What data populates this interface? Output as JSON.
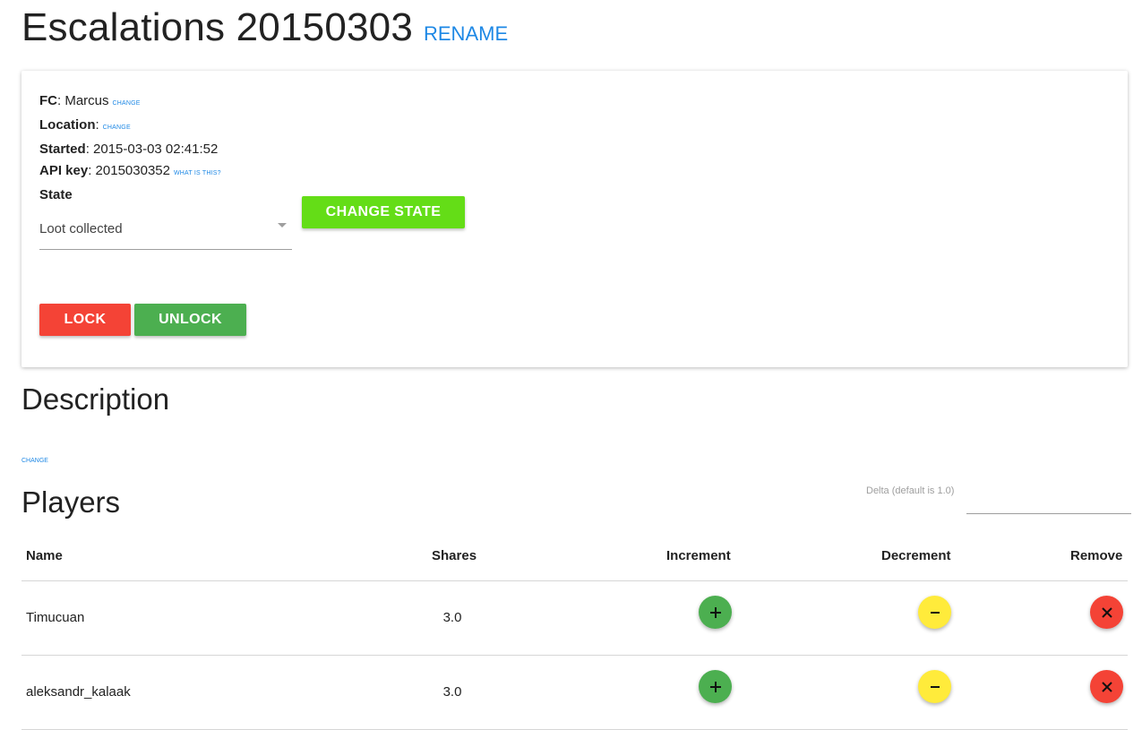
{
  "header": {
    "title": "Escalations 20150303",
    "rename_label": "RENAME"
  },
  "info": {
    "fc_label": "FC",
    "fc_value": "Marcus",
    "fc_change": "CHANGE",
    "location_label": "Location",
    "location_change": "CHANGE",
    "started_label": "Started",
    "started_value": "2015-03-03 02:41:52",
    "api_label": "API key",
    "api_value": "2015030352",
    "api_help": "WHAT IS THIS?",
    "state_label": "State"
  },
  "state_select": {
    "value": "Loot collected"
  },
  "buttons": {
    "change_state": "CHANGE STATE",
    "lock": "LOCK",
    "unlock": "UNLOCK"
  },
  "description": {
    "title": "Description",
    "change": "CHANGE"
  },
  "players": {
    "title": "Players",
    "delta_label": "Delta (default is 1.0)",
    "columns": {
      "name": "Name",
      "shares": "Shares",
      "increment": "Increment",
      "decrement": "Decrement",
      "remove": "Remove"
    },
    "rows": [
      {
        "name": "Timucuan",
        "shares": "3.0"
      },
      {
        "name": "aleksandr_kalaak",
        "shares": "3.0"
      }
    ]
  },
  "colors": {
    "accent_link": "#1e88e5",
    "change_state": "#64dd17",
    "lock": "#f44336",
    "unlock": "#4caf50",
    "increment": "#4caf50",
    "decrement": "#ffeb3b",
    "remove": "#f44336"
  },
  "icons": {
    "increment": "plus-icon",
    "decrement": "minus-icon",
    "remove": "close-icon",
    "select": "caret-down-icon"
  }
}
